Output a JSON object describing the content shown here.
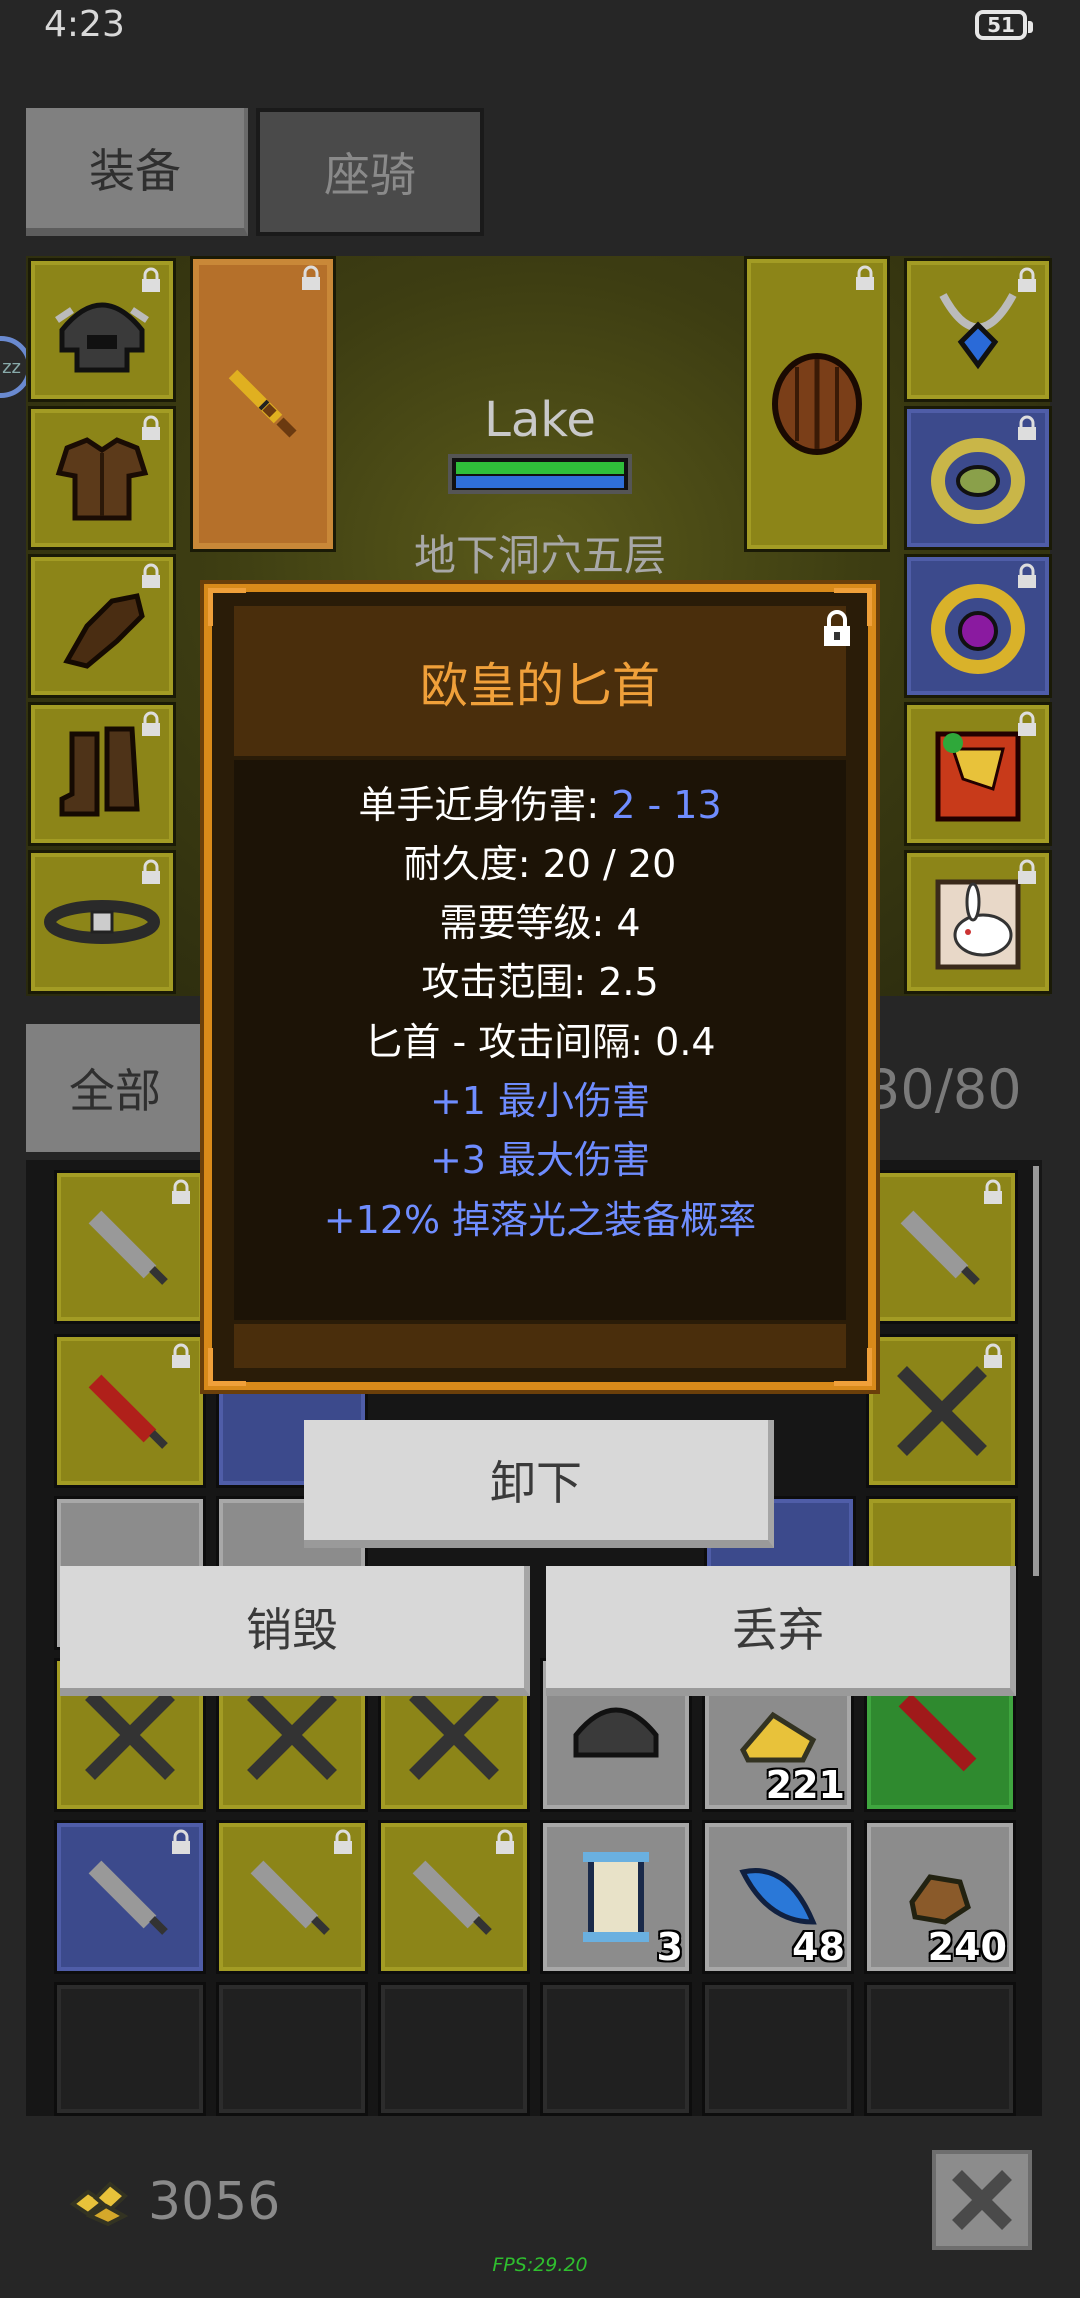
{
  "status": {
    "time": "4:23",
    "battery": "51"
  },
  "tabs": {
    "equipment": "装备",
    "mount": "座骑"
  },
  "player": {
    "name": "Lake",
    "location": "地下洞穴五层"
  },
  "equip_slots": {
    "left": [
      {
        "icon": "helmet-icon",
        "color": "yellow"
      },
      {
        "icon": "armor-icon",
        "color": "yellow"
      },
      {
        "icon": "gloves-icon",
        "color": "yellow"
      },
      {
        "icon": "boots-icon",
        "color": "yellow"
      },
      {
        "icon": "belt-icon",
        "color": "yellow"
      }
    ],
    "weapon": {
      "icon": "dagger-icon",
      "color": "orange"
    },
    "offhand": {
      "icon": "shield-icon",
      "color": "yellow"
    },
    "right": [
      {
        "icon": "necklace-icon",
        "color": "yellow"
      },
      {
        "icon": "ring-icon",
        "color": "blue"
      },
      {
        "icon": "ring-purple-icon",
        "color": "blue"
      },
      {
        "icon": "book-icon",
        "color": "yellow"
      },
      {
        "icon": "rabbit-pet-icon",
        "color": "yellow"
      }
    ]
  },
  "inventory": {
    "filter_label": "全部",
    "capacity": "30/80",
    "visible_counts": {
      "gold_ore": "221",
      "scroll": "3",
      "feather": "48",
      "ore": "240"
    }
  },
  "tooltip": {
    "title": "欧皇的匕首",
    "lines": {
      "damage_label": "单手近身伤害: ",
      "damage_value": "2 - 13",
      "durability": "耐久度: 20 / 20",
      "level": "需要等级: 4",
      "range": "攻击范围: 2.5",
      "interval": "匕首 - 攻击间隔: 0.4",
      "bonus1": "+1 最小伤害",
      "bonus2": "+3 最大伤害",
      "bonus3": "+12% 掉落光之装备概率"
    }
  },
  "actions": {
    "unequip": "卸下",
    "destroy": "销毁",
    "drop": "丢弃"
  },
  "footer": {
    "gold": "3056",
    "fps": "FPS:29.20"
  },
  "colors": {
    "tooltip_border": "#d98a1a",
    "tooltip_title": "#f0a03a",
    "stat_highlight": "#6f8dff"
  }
}
